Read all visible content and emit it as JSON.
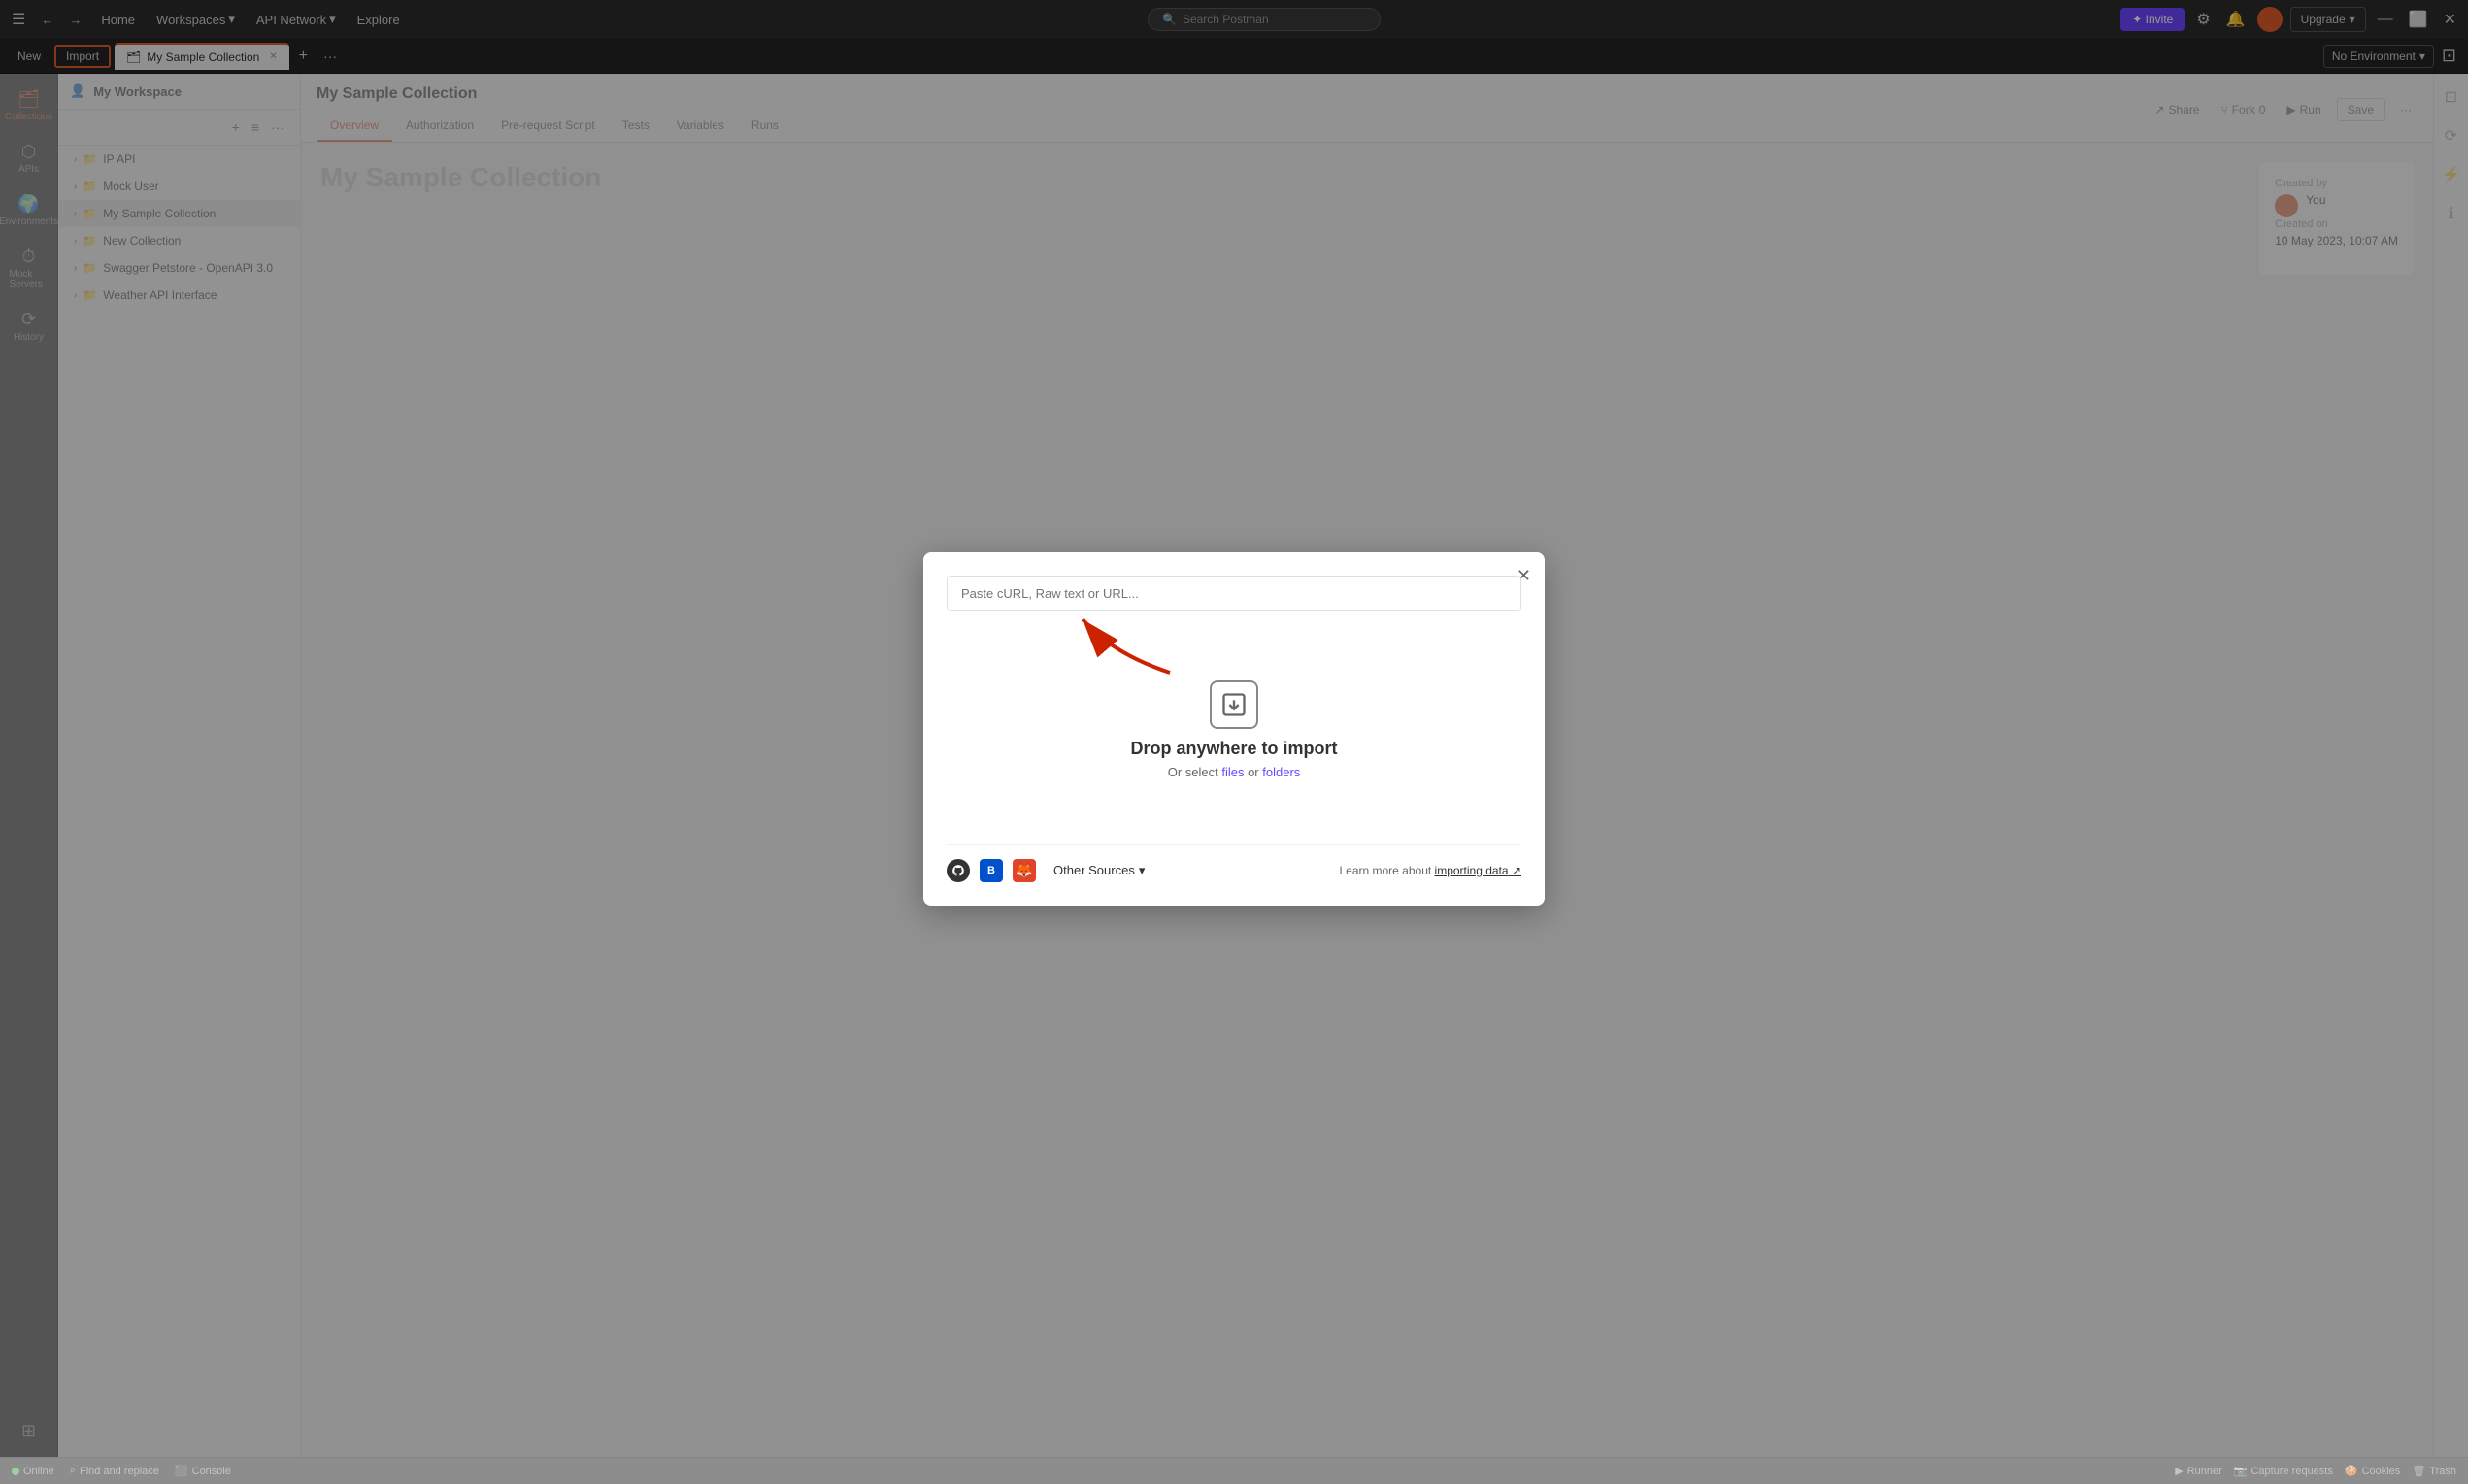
{
  "topbar": {
    "hamburger_label": "☰",
    "back_label": "←",
    "forward_label": "→",
    "home_label": "Home",
    "workspaces_label": "Workspaces",
    "api_network_label": "API Network",
    "explore_label": "Explore",
    "search_placeholder": "Search Postman",
    "invite_label": "✦ Invite",
    "settings_icon": "⚙",
    "bell_icon": "🔔",
    "upgrade_label": "Upgrade",
    "upgrade_arrow": "▾",
    "minimize_label": "—",
    "maximize_label": "⬜",
    "close_label": "✕"
  },
  "tabbar": {
    "new_label": "New",
    "import_label": "Import",
    "active_tab_icon": "🗂",
    "active_tab_label": "My Sample Collection",
    "close_tab": "✕",
    "add_tab": "+",
    "more_tabs": "···",
    "env_label": "No Environment",
    "env_arrow": "▾"
  },
  "sidebar": {
    "workspace_label": "My Workspace",
    "add_btn": "+",
    "filter_btn": "≡",
    "more_btn": "···",
    "items": [
      {
        "id": "ip-api",
        "label": "IP API",
        "icon": ">"
      },
      {
        "id": "mock-user",
        "label": "Mock User",
        "icon": ">"
      },
      {
        "id": "my-sample-collection",
        "label": "My Sample Collection",
        "icon": ">",
        "active": true
      },
      {
        "id": "new-collection",
        "label": "New Collection",
        "icon": ">"
      },
      {
        "id": "swagger-petstore",
        "label": "Swagger Petstore - OpenAPI 3.0",
        "icon": ">"
      },
      {
        "id": "weather-api",
        "label": "Weather API Interface",
        "icon": ">"
      }
    ]
  },
  "sidebar_icons": {
    "collections": {
      "symbol": "🗂",
      "label": "Collections",
      "active": true
    },
    "apis": {
      "symbol": "⬡",
      "label": "APIs"
    },
    "environments": {
      "symbol": "🌍",
      "label": "Environments"
    },
    "mock_servers": {
      "symbol": "⏱",
      "label": "Mock Servers"
    },
    "history": {
      "symbol": "⟳",
      "label": "History"
    },
    "bottom": {
      "symbol": "⊞",
      "label": ""
    }
  },
  "content": {
    "title": "My Sample Collection",
    "tabs": [
      "Overview",
      "Authorization",
      "Pre-request Script",
      "Tests",
      "Variables",
      "Runs"
    ],
    "active_tab": "Overview",
    "share_label": "Share",
    "fork_label": "Fork",
    "fork_count": "0",
    "run_label": "Run",
    "save_label": "Save",
    "more_label": "···",
    "bg_title": "My Sample Collection",
    "created_by_label": "Created by",
    "creator_name": "You",
    "created_on_label": "Created on",
    "created_date": "10 May 2023, 10:07 AM"
  },
  "modal": {
    "close_btn": "✕",
    "input_placeholder": "Paste cURL, Raw text or URL...",
    "drop_title": "Drop anywhere to import",
    "drop_subtitle_prefix": "Or select ",
    "drop_files_link": "files",
    "drop_or": " or ",
    "drop_folders_link": "folders",
    "github_icon": "⌥",
    "bitbucket_label": "B",
    "gitlab_label": "🦊",
    "other_sources_label": "Other Sources",
    "other_sources_arrow": "▾",
    "learn_more_text": "Learn more about ",
    "importing_data_link": "importing data",
    "importing_data_arrow": "↗"
  },
  "statusbar": {
    "online_label": "Online",
    "find_replace_label": "Find and replace",
    "console_label": "Console",
    "runner_label": "Runner",
    "capture_label": "Capture requests",
    "cookies_label": "Cookies",
    "trash_label": "Trash"
  },
  "right_sidebar": {
    "icon1": "⊡",
    "icon2": "⟳",
    "icon3": "⚡",
    "icon4": "ℹ"
  }
}
